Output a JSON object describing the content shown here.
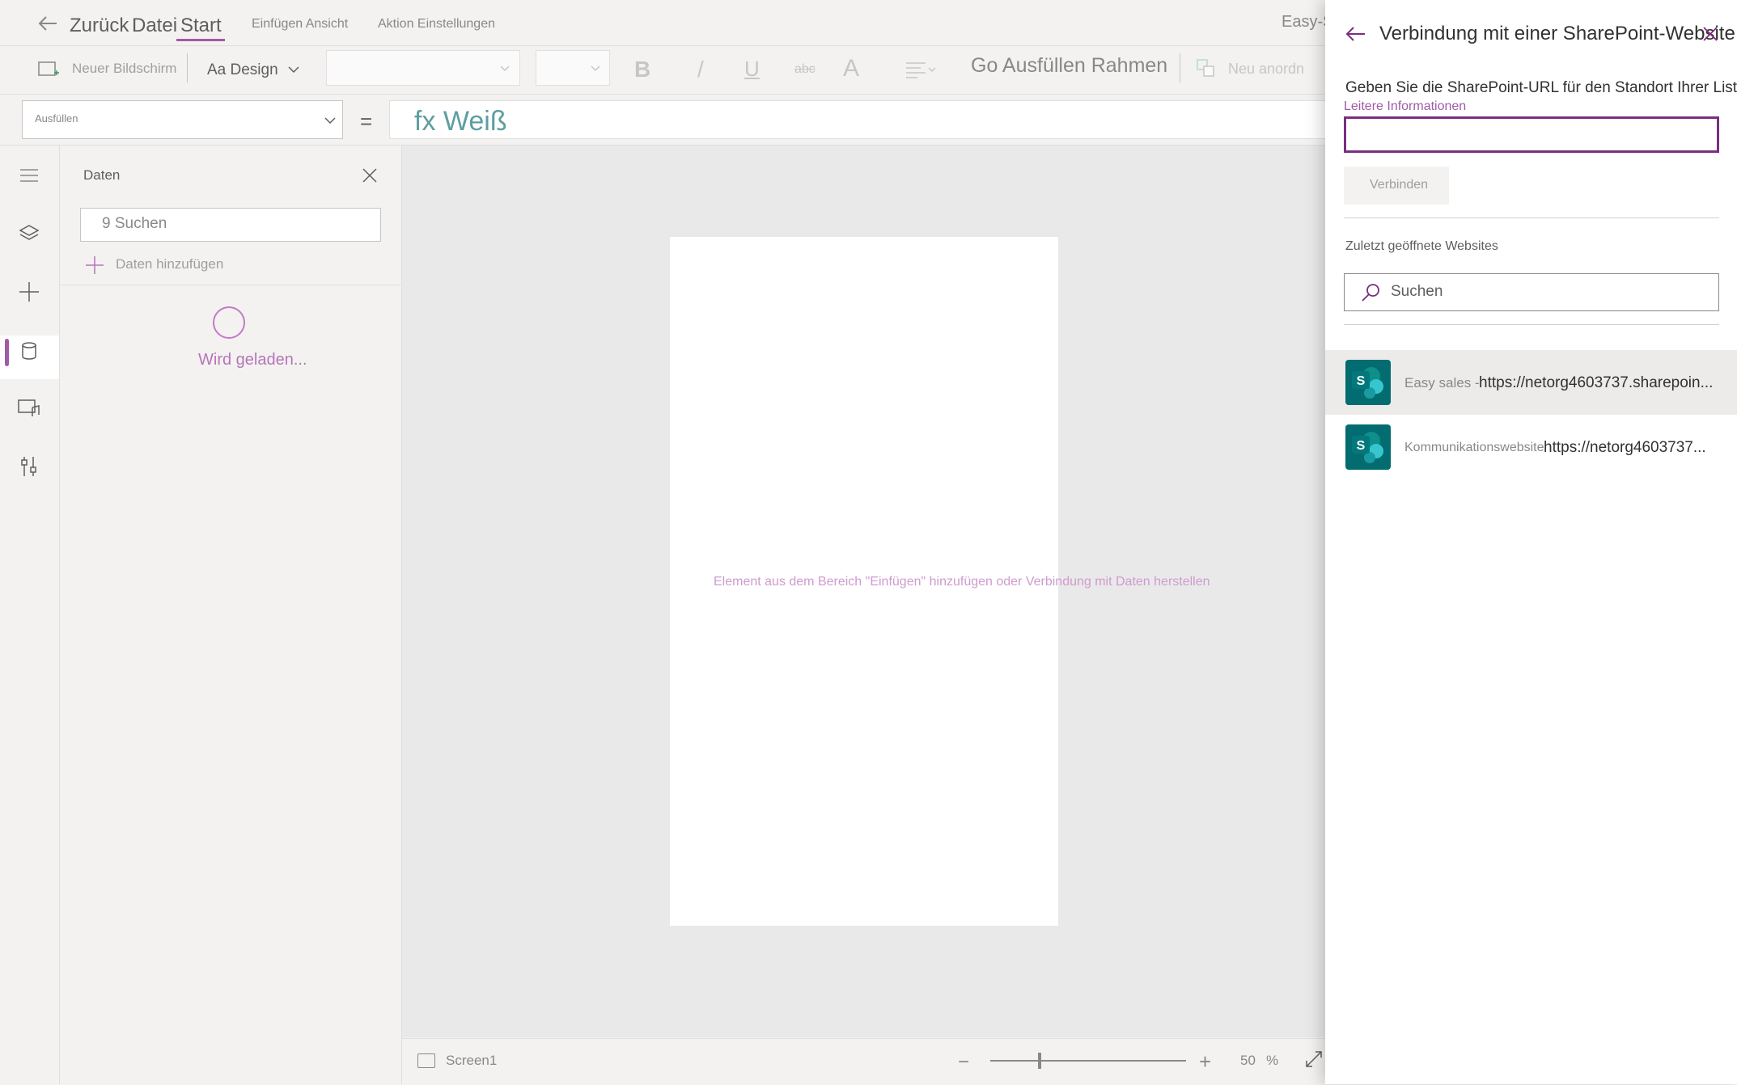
{
  "menubar": {
    "back_label": "Zurück",
    "file_label": "Datei",
    "start_label": "Start",
    "insert_view_label": "Einfügen Ansicht",
    "action_settings_label": "Aktion Einstellungen",
    "app_title": "Easy-S"
  },
  "ribbon": {
    "new_screen_label": "Neuer Bildschirm",
    "design_label": "Aa Design",
    "fill_border_label": "Go Ausfüllen Rahmen",
    "reorder_label": "Neu anordn",
    "bold": "B",
    "italic": "/",
    "underline": "U",
    "strike": "abc",
    "font_color": "A"
  },
  "formula": {
    "property": "Ausfüllen",
    "equals": "=",
    "value": "fx Weiß"
  },
  "data_panel": {
    "title": "Daten",
    "search_placeholder": "9 Suchen",
    "add_data_label": "Daten hinzufügen",
    "loading_text": "Wird geladen..."
  },
  "canvas": {
    "hint": "Element aus dem Bereich \"Einfügen\" hinzufügen oder Verbindung mit Daten herstellen"
  },
  "status": {
    "screen_name": "Screen1",
    "zoom_value": "50",
    "zoom_unit": "%",
    "zoom_percent": 50
  },
  "flyout": {
    "title": "Verbindung mit einer SharePoint-Website",
    "heading": "Geben Sie die SharePoint-URL für den Standort Ihrer List",
    "more_info": "Leitere Informationen",
    "url_value": "",
    "connect_label": "Verbinden",
    "recent_label": "Zuletzt geöffnete Websites",
    "search_placeholder": "Suchen",
    "sites": [
      {
        "name": "Easy sales -",
        "url": "https://netorg4603737.sharepoin..."
      },
      {
        "name": "Kommunikationswebsite",
        "url": "https://netorg4603737..."
      }
    ]
  },
  "colors": {
    "accent": "#a05ba6",
    "input_border": "#7a2e7f",
    "sharepoint": "#036c70",
    "formula_text": "#5e9ea0"
  }
}
